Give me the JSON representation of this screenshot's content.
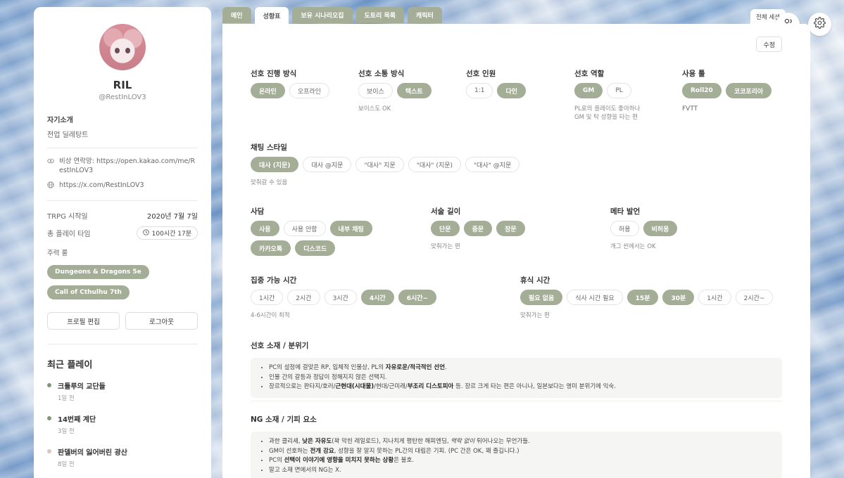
{
  "profile": {
    "name": "RIL",
    "handle": "@RestInLOV3",
    "intro_label": "자기소개",
    "intro_value": "전업 딜레탕트",
    "contact": "비상 연락망: https://open.kakao.com/me/RestInLOV3",
    "twitter": "https://x.com/RestInLOV3",
    "trpg_start_label": "TRPG 시작일",
    "trpg_start_value": "2020년 7월 7일",
    "playtime_label": "총 플레이 타임",
    "playtime_value": "100시간 17분",
    "main_rules_label": "주력 룰",
    "main_rules": [
      "Dungeons & Dragons 5e",
      "Call of Cthulhu 7th"
    ],
    "edit_profile": "프로필 편집",
    "logout": "로그아웃"
  },
  "recent": {
    "title": "최근 플레이",
    "items": [
      {
        "title": "크툴루의 교단들",
        "date": "1일 전"
      },
      {
        "title": "14번째 계단",
        "date": "3일 전"
      },
      {
        "title": "판델버의 잃어버린 광산",
        "date": "8일 전"
      }
    ]
  },
  "tabs": [
    "메인",
    "성향표",
    "보유 시나리오집",
    "도토리 목록",
    "캐릭터"
  ],
  "active_tab": "성향표",
  "all_sessions_tab": "전체 세션",
  "edit_label": "수정",
  "prefs": {
    "progress": {
      "title": "선호 진행 방식",
      "chips": [
        "온라인",
        "오프라인"
      ]
    },
    "comm": {
      "title": "선호 소통 방식",
      "chips": [
        "보이스",
        "텍스트"
      ],
      "note": "보이스도 OK"
    },
    "people": {
      "title": "선호 인원",
      "chips": [
        "1:1",
        "다인"
      ]
    },
    "role": {
      "title": "선호 역할",
      "chips": [
        "GM",
        "PL"
      ],
      "note1": "PL로의 플레이도 좋아하나",
      "note2": "GM 및 탁 성향을 타는 편"
    },
    "tools": {
      "title": "사용 툴",
      "chips": [
        "Roll20",
        "코코포리아"
      ],
      "note": "FVTT"
    },
    "chat": {
      "title": "채팅 스타일",
      "chips": [
        "대사 (지문)",
        "대사 @지문",
        "\"대사\" 지문",
        "\"대사\" (지문)",
        "\"대사\" @지문"
      ],
      "note": "맞춰갈 수 있음"
    },
    "side": {
      "title": "사담",
      "chips": [
        "사용",
        "사용 안함",
        "내부 채팅",
        "카카오톡",
        "디스코드"
      ]
    },
    "length": {
      "title": "서술 길이",
      "chips": [
        "단문",
        "중문",
        "장문"
      ],
      "note": "맞춰가는 편"
    },
    "meta": {
      "title": "메타 발언",
      "chips": [
        "허용",
        "비허용"
      ],
      "note": "개그 씬에서는 OK"
    },
    "focus": {
      "title": "집중 가능 시간",
      "chips": [
        "1시간",
        "2시간",
        "3시간",
        "4시간",
        "6시간~"
      ],
      "note": "4-6시간이 최적"
    },
    "rest": {
      "title": "휴식 시간",
      "chips": [
        "필요 없음",
        "식사 시간 필요",
        "15분",
        "30분",
        "1시간",
        "2시간~"
      ],
      "note": "맞춰가는 편"
    }
  },
  "likes": {
    "title": "선호 소재 / 분위기",
    "l1a": "PC의 설정에 걸맞은 RP, 입체적 인물상, PL의 ",
    "l1b": "자유로운/적극적인 선언",
    "l1c": ".",
    "l2": "인물 간의 갈등과 정답이 정해지지 않은 선택지.",
    "l3a": "장르적으로는 판타지/호러/",
    "l3b": "근현대(시대물)",
    "l3c": "/현대/근미래/",
    "l3d": "부조리 디스토피아",
    "l3e": " 등. 장르 크게 타는 편은 아니나, 일본보다는 영미 분위기에 익숙."
  },
  "ng": {
    "title": "NG 소재 / 기피 요소",
    "l1a": "과한 클리셰, ",
    "l1b": "낮은 자유도",
    "l1c": "(꽉 막힌 레일로드), 지나치게 평탄한 해피엔딩, ",
    "l1d": "맥락 없이",
    "l1e": " 튀어나오는 무언가들.",
    "l2a": "GM이 선호하는 ",
    "l2b": "전개 강요",
    "l2c": ", 성향을 잘 알지 못하는 PL간의 대립은 기피. (PC 간은 OK, 꽤 즐깁니다.)",
    "l3a": "PC의 ",
    "l3b": "선택이 이야기에 영향을 미치지 못하는 상황",
    "l3c": "은 불호.",
    "l4": "말고 소재 면에서의 NG는 X."
  },
  "colors": {
    "accent": "#a4ad96",
    "dot": "#7e9a74"
  }
}
